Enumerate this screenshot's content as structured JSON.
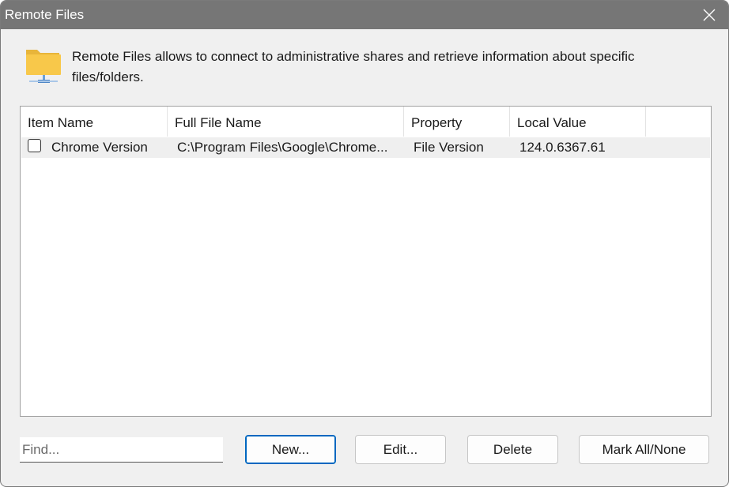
{
  "window": {
    "title": "Remote Files"
  },
  "info": {
    "text": "Remote Files allows to connect to administrative shares and retrieve information about specific files/folders.",
    "icon": "network-folder-icon",
    "icon_color": "#f8c84a"
  },
  "list": {
    "columns": [
      "Item Name",
      "Full File Name",
      "Property",
      "Local Value"
    ],
    "rows": [
      {
        "checked": false,
        "item_name": "Chrome Version",
        "full_file_name": "C:\\Program Files\\Google\\Chrome...",
        "property": "File Version",
        "local_value": "124.0.6367.61"
      }
    ]
  },
  "footer": {
    "find_placeholder": "Find...",
    "find_value": "",
    "new_label": "New...",
    "edit_label": "Edit...",
    "delete_label": "Delete",
    "mark_all_label": "Mark All/None"
  },
  "colors": {
    "titlebar": "#767676",
    "accent": "#0067c0",
    "row_background": "#efefef"
  }
}
